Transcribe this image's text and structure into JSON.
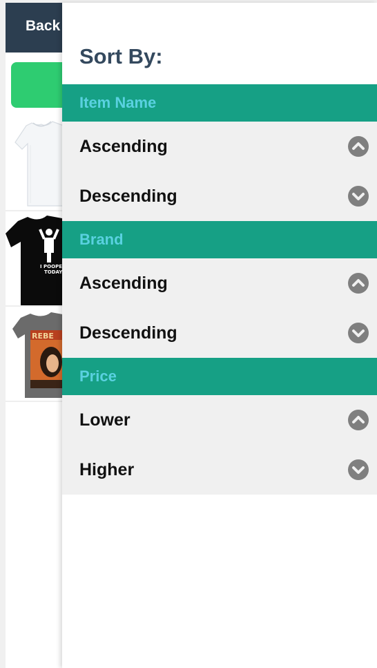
{
  "background": {
    "back_label": "Back",
    "colors": {
      "header": "#2c3e50",
      "action_button": "#2ecc71"
    }
  },
  "sort_panel": {
    "title": "Sort By:",
    "colors": {
      "section_bg": "#16a085",
      "section_text": "#5ad1e0",
      "option_bg": "#f0f0f0",
      "icon": "#7f7f7f"
    },
    "sections": [
      {
        "header": "Item Name",
        "options": [
          {
            "label": "Ascending",
            "icon": "chevron-up-circle-icon"
          },
          {
            "label": "Descending",
            "icon": "chevron-down-circle-icon"
          }
        ]
      },
      {
        "header": "Brand",
        "options": [
          {
            "label": "Ascending",
            "icon": "chevron-up-circle-icon"
          },
          {
            "label": "Descending",
            "icon": "chevron-down-circle-icon"
          }
        ]
      },
      {
        "header": "Price",
        "options": [
          {
            "label": "Lower",
            "icon": "chevron-up-circle-icon"
          },
          {
            "label": "Higher",
            "icon": "chevron-down-circle-icon"
          }
        ]
      }
    ]
  }
}
